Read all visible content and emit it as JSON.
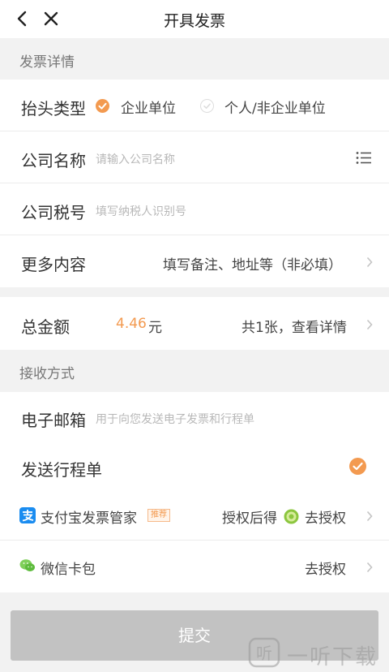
{
  "nav": {
    "title": "开具发票"
  },
  "section_invoice": {
    "title": "发票详情"
  },
  "header_type": {
    "label": "抬头类型",
    "option_company": "企业单位",
    "option_personal": "个人/非企业单位",
    "selected": "企业单位"
  },
  "company_name": {
    "label": "公司名称",
    "placeholder": "请输入公司名称"
  },
  "tax_number": {
    "label": "公司税号",
    "placeholder": "填写纳税人识别号"
  },
  "more": {
    "label": "更多内容",
    "hint": "填写备注、地址等（非必填）"
  },
  "total": {
    "label": "总金额",
    "amount": "4.46",
    "unit": "元",
    "detail": "共1张，查看详情"
  },
  "section_receive": {
    "title": "接收方式"
  },
  "email": {
    "label": "电子邮箱",
    "placeholder": "用于向您发送电子发票和行程单"
  },
  "send_itinerary": {
    "label": "发送行程单",
    "checked": true
  },
  "alipay": {
    "label": "支付宝发票管家",
    "tag": "推荐",
    "hint": "授权后得",
    "action": "去授权"
  },
  "wechat": {
    "label": "微信卡包",
    "action": "去授权"
  },
  "submit": {
    "label": "提交"
  },
  "watermark": {
    "text": "一听下载"
  },
  "colors": {
    "accent": "#f39a50",
    "alipay_blue": "#1a8cf0",
    "wechat_green": "#07c160",
    "submit_disabled": "#c2c2c2"
  }
}
